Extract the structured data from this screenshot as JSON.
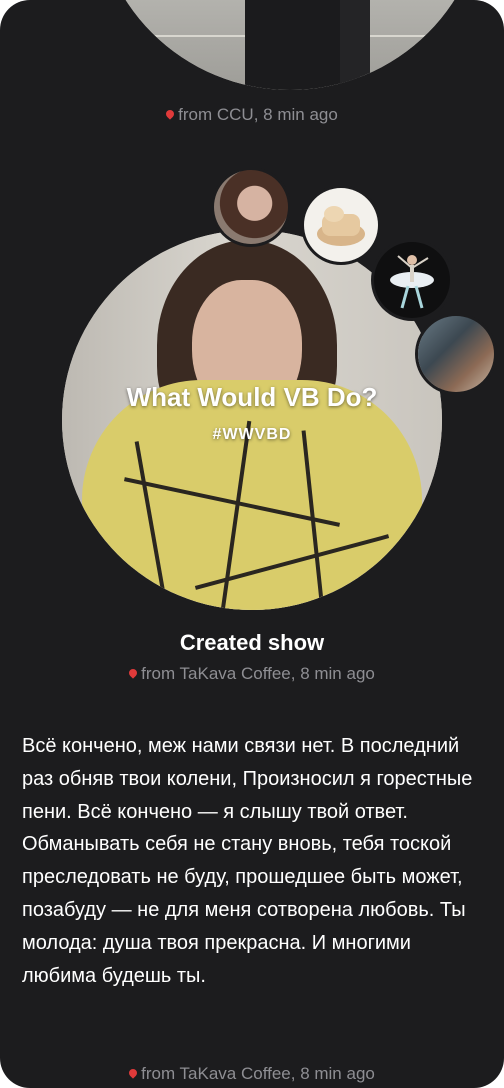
{
  "feed": {
    "previous_post": {
      "location_text": "from CCU, 8 min ago"
    },
    "show_post": {
      "overlay_title": "What Would VB Do?",
      "overlay_hashtag": "#WWVBD",
      "mute_icon": "speaker-muted-icon",
      "title": "Created show",
      "location_text": "from TaKava Coffee, 8 min ago",
      "thumbnails": [
        {
          "name": "woman-portrait"
        },
        {
          "name": "bread-loaf"
        },
        {
          "name": "ballerina"
        },
        {
          "name": "street-scene"
        }
      ]
    },
    "text_post": {
      "body": "Всё кончено, меж нами связи нет. В последний раз обняв твои колени, Произносил я горестные пени. Всё кончено — я слышу твой ответ. Обманывать себя не стану вновь, тебя тоской преследовать не буду, прошедшее быть может, позабуду — не для меня сотворена любовь. Ты молода: душа твоя прекрасна. И многими любима будешь ты.",
      "location_text": "from TaKava Coffee, 8 min ago"
    }
  },
  "colors": {
    "background": "#1c1c1e",
    "meta_text": "#8e8e93",
    "pin": "#e03a3a",
    "text": "#ffffff"
  }
}
